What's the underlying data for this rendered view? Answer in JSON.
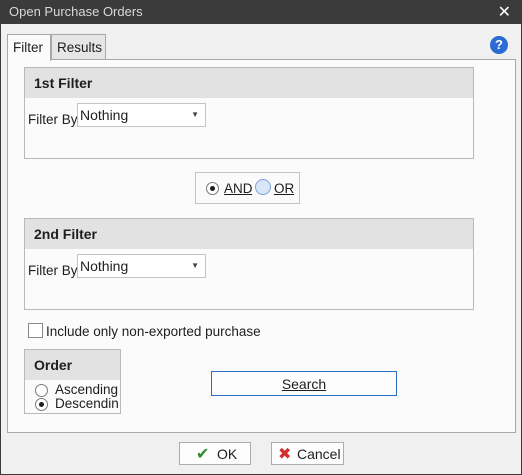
{
  "window": {
    "title": "Open Purchase Orders",
    "close_glyph": "✕"
  },
  "tabs": [
    {
      "label": "Filter",
      "active": true
    },
    {
      "label": "Results",
      "active": false
    }
  ],
  "help_glyph": "?",
  "filter1": {
    "heading": "1st Filter",
    "label": "Filter By",
    "value": "Nothing"
  },
  "logic": {
    "and_label": "AND",
    "or_label": "OR",
    "selected": "AND"
  },
  "filter2": {
    "heading": "2nd Filter",
    "label": "Filter By",
    "value": "Nothing"
  },
  "non_exported": {
    "label": "Include only non-exported purchase",
    "checked": false
  },
  "order": {
    "heading": "Order",
    "options": [
      "Ascending",
      "Descending"
    ],
    "selected": "Descending"
  },
  "search_label": "Search",
  "buttons": {
    "ok_label": "OK",
    "cancel_label": "Cancel"
  },
  "icons": {
    "ok": "check-icon",
    "cancel": "x-icon",
    "help": "help-icon"
  },
  "colors": {
    "titlebar": "#3b3b3b",
    "accent": "#2b6bd3",
    "ok_check": "#2e8b2e",
    "cancel_x": "#d32f2f"
  }
}
